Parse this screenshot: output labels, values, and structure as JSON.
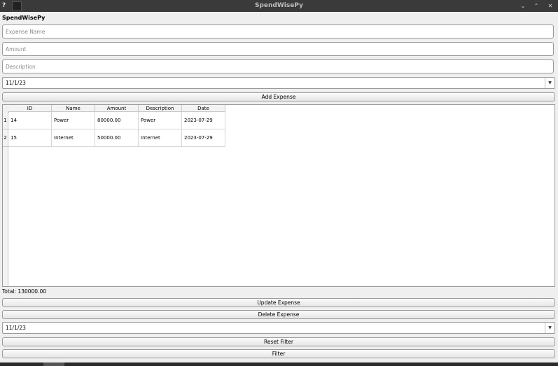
{
  "window": {
    "title": "SpendWisePy",
    "help_glyph": "?",
    "minimize_glyph": "⌄",
    "maximize_glyph": "⌃",
    "close_glyph": "✕"
  },
  "app": {
    "label": "SpendWisePy"
  },
  "form": {
    "name_placeholder": "Expense Name",
    "amount_placeholder": "Amount",
    "description_placeholder": "Description",
    "date_value": "11/1/23",
    "add_label": "Add Expense"
  },
  "table": {
    "columns": [
      "ID",
      "Name",
      "Amount",
      "Description",
      "Date"
    ],
    "rows": [
      {
        "num": "1",
        "cells": [
          "14",
          "Power",
          "80000.00",
          "Power",
          "2023-07-29"
        ]
      },
      {
        "num": "2",
        "cells": [
          "15",
          "Internet",
          "50000.00",
          "Internet",
          "2023-07-29"
        ]
      }
    ]
  },
  "summary": {
    "total": "Total: 130000.00"
  },
  "actions": {
    "update_label": "Update Expense",
    "delete_label": "Delete Expense",
    "filter_date_value": "11/1/23",
    "reset_filter_label": "Reset Filter",
    "filter_label": "Filter"
  },
  "colors": {
    "titlebar": "#3a3a3a",
    "window_bg": "#efefef",
    "field_bg": "#ffffff"
  },
  "icons": {
    "dropdown": "chevron-down-icon",
    "help": "help-icon"
  }
}
